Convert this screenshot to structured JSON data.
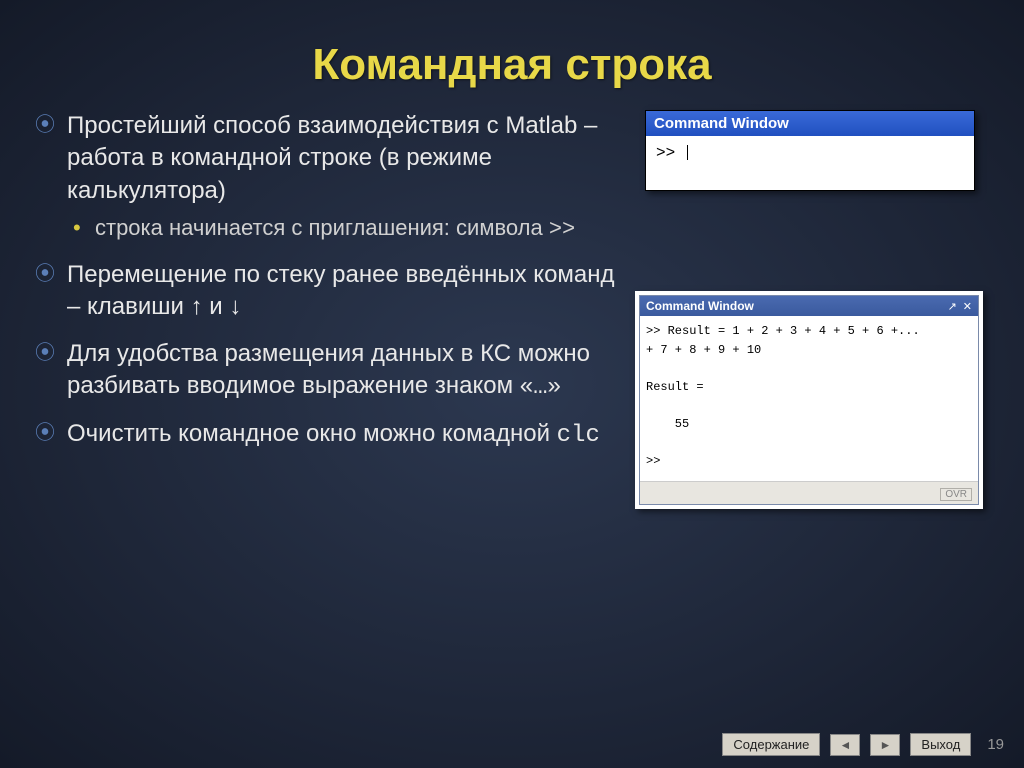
{
  "title": "Командная строка",
  "bullets": {
    "b1": "Простейший способ взаимодействия с Matlab – работа в командной строке (в режиме калькулятора)",
    "b1_sub_pre": "строка начинается с приглашения: символа ",
    "b1_sub_sym": ">>",
    "b2": "Перемещение по стеку ранее введённых команд – клавиши ↑ и ↓",
    "b3_pre": "Для удобства размещения данных в КС можно разбивать вводимое выражение знаком «",
    "b3_sym": "…",
    "b3_post": "»",
    "b4_pre": "Очистить командное окно можно комадной ",
    "b4_cmd": "clc"
  },
  "win1": {
    "title": "Command Window",
    "prompt": ">> "
  },
  "win2": {
    "title": "Command Window",
    "body": ">> Result = 1 + 2 + 3 + 4 + 5 + 6 +...\n+ 7 + 8 + 9 + 10\n\nResult =\n\n    55\n\n>>",
    "ovr": "OVR"
  },
  "footer": {
    "contents": "Содержание",
    "exit": "Выход",
    "page": "19"
  }
}
